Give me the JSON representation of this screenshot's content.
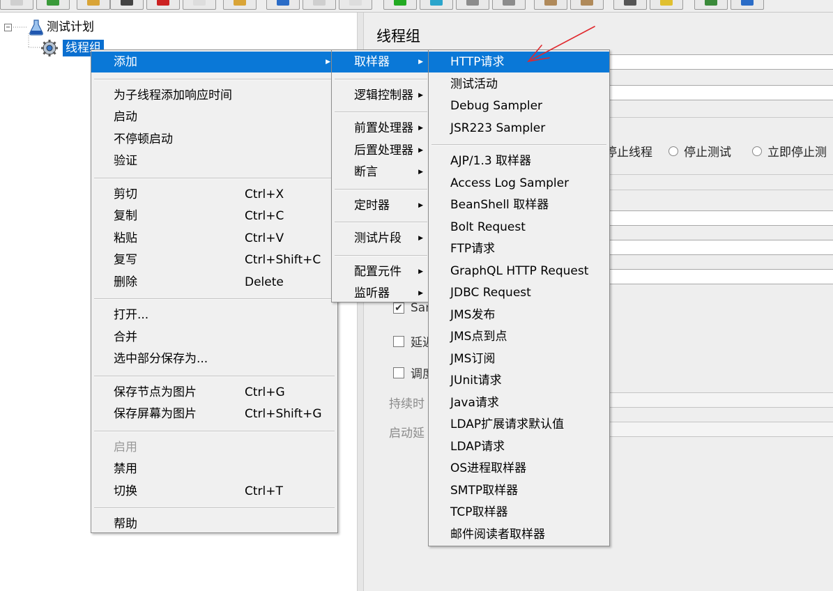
{
  "toolbar": {
    "buttons": [
      {
        "name": "toolbar-button-new",
        "icon": "blank-doc-icon",
        "color": "#cfcfcf"
      },
      {
        "name": "toolbar-button-templates",
        "icon": "template-icon",
        "color": "#3a9a3a"
      },
      {
        "name": "toolbar-button-open",
        "icon": "folder-icon",
        "color": "#d9a437"
      },
      {
        "name": "toolbar-button-save",
        "icon": "floppy-icon",
        "color": "#444444"
      },
      {
        "name": "toolbar-button-cut",
        "icon": "scissors-icon",
        "color": "#cc2222"
      },
      {
        "name": "toolbar-button-copy",
        "icon": "copy-icon",
        "color": "#dddddd"
      },
      {
        "name": "toolbar-button-paste",
        "icon": "clipboard-icon",
        "color": "#d9a437"
      },
      {
        "name": "toolbar-button-expand",
        "icon": "plus-icon",
        "color": "#2a6cc7"
      },
      {
        "name": "toolbar-button-collapse",
        "icon": "minus-icon",
        "color": "#cfcfcf"
      },
      {
        "name": "toolbar-button-toggle",
        "icon": "toggle-icon",
        "color": "#dddddd"
      },
      {
        "name": "toolbar-button-start",
        "icon": "play-icon",
        "color": "#22aa22"
      },
      {
        "name": "toolbar-button-start-no-pause",
        "icon": "play-timer-icon",
        "color": "#2aa5cc"
      },
      {
        "name": "toolbar-button-stop",
        "icon": "stop-icon",
        "color": "#8c8c8c"
      },
      {
        "name": "toolbar-button-shutdown",
        "icon": "shutdown-icon",
        "color": "#8c8c8c"
      },
      {
        "name": "toolbar-button-clear",
        "icon": "broom-icon",
        "color": "#b08a5a"
      },
      {
        "name": "toolbar-button-clear-all",
        "icon": "broom-all-icon",
        "color": "#b08a5a"
      },
      {
        "name": "toolbar-button-search",
        "icon": "binoculars-icon",
        "color": "#555555"
      },
      {
        "name": "toolbar-button-reset-search",
        "icon": "reset-search-icon",
        "color": "#e0c030"
      },
      {
        "name": "toolbar-button-function-helper",
        "icon": "list-icon",
        "color": "#3a8a3a"
      },
      {
        "name": "toolbar-button-help",
        "icon": "help-icon",
        "color": "#2a6cc7"
      }
    ]
  },
  "tree": {
    "root": {
      "label": "测试计划",
      "icon": "flask-icon",
      "toggle": "⊟"
    },
    "child": {
      "label": "线程组",
      "icon": "gear-icon"
    }
  },
  "panel": {
    "title": "线程组",
    "radios": [
      "停止线程",
      "停止测试",
      "立即停止测"
    ],
    "checkboxes": [
      {
        "label": "Sam",
        "checked": true
      },
      {
        "label": "延迟",
        "checked": false
      },
      {
        "label": "调度",
        "checked": false
      }
    ],
    "faded_labels": [
      "持续时",
      "启动延"
    ]
  },
  "menu_main": {
    "groups": [
      [
        {
          "label": "添加",
          "submenu": true,
          "highlighted": true
        }
      ],
      [
        {
          "label": "为子线程添加响应时间"
        },
        {
          "label": "启动"
        },
        {
          "label": "不停顿启动"
        },
        {
          "label": "验证"
        }
      ],
      [
        {
          "label": "剪切",
          "shortcut": "Ctrl+X"
        },
        {
          "label": "复制",
          "shortcut": "Ctrl+C"
        },
        {
          "label": "粘贴",
          "shortcut": "Ctrl+V"
        },
        {
          "label": "复写",
          "shortcut": "Ctrl+Shift+C"
        },
        {
          "label": "删除",
          "shortcut": "Delete"
        }
      ],
      [
        {
          "label": "打开..."
        },
        {
          "label": "合并"
        },
        {
          "label": "选中部分保存为..."
        }
      ],
      [
        {
          "label": "保存节点为图片",
          "shortcut": "Ctrl+G"
        },
        {
          "label": "保存屏幕为图片",
          "shortcut": "Ctrl+Shift+G"
        }
      ],
      [
        {
          "label": "启用",
          "disabled": true
        },
        {
          "label": "禁用"
        },
        {
          "label": "切换",
          "shortcut": "Ctrl+T"
        }
      ],
      [
        {
          "label": "帮助"
        }
      ]
    ]
  },
  "menu_add": {
    "groups": [
      [
        {
          "label": "取样器",
          "submenu": true,
          "highlighted": true
        }
      ],
      [
        {
          "label": "逻辑控制器",
          "submenu": true
        }
      ],
      [
        {
          "label": "前置处理器",
          "submenu": true
        },
        {
          "label": "后置处理器",
          "submenu": true
        },
        {
          "label": "断言",
          "submenu": true
        }
      ],
      [
        {
          "label": "定时器",
          "submenu": true
        }
      ],
      [
        {
          "label": "测试片段",
          "submenu": true
        }
      ],
      [
        {
          "label": "配置元件",
          "submenu": true
        },
        {
          "label": "监听器",
          "submenu": true
        }
      ]
    ]
  },
  "menu_sampler": {
    "groups": [
      [
        {
          "label": "HTTP请求",
          "highlighted": true
        },
        {
          "label": "测试活动"
        },
        {
          "label": "Debug Sampler"
        },
        {
          "label": "JSR223 Sampler"
        }
      ],
      [
        {
          "label": "AJP/1.3 取样器"
        },
        {
          "label": "Access Log Sampler"
        },
        {
          "label": "BeanShell 取样器"
        },
        {
          "label": "Bolt Request"
        },
        {
          "label": "FTP请求"
        },
        {
          "label": "GraphQL HTTP Request"
        },
        {
          "label": "JDBC Request"
        },
        {
          "label": "JMS发布"
        },
        {
          "label": "JMS点到点"
        },
        {
          "label": "JMS订阅"
        },
        {
          "label": "JUnit请求"
        },
        {
          "label": "Java请求"
        },
        {
          "label": "LDAP扩展请求默认值"
        },
        {
          "label": "LDAP请求"
        },
        {
          "label": "OS进程取样器"
        },
        {
          "label": "SMTP取样器"
        },
        {
          "label": "TCP取样器"
        },
        {
          "label": "邮件阅读者取样器"
        }
      ]
    ]
  },
  "colors": {
    "highlight": "#0a78d7",
    "annotation_arrow": "#e0282d",
    "tree_selection": "#0a6fd0"
  }
}
